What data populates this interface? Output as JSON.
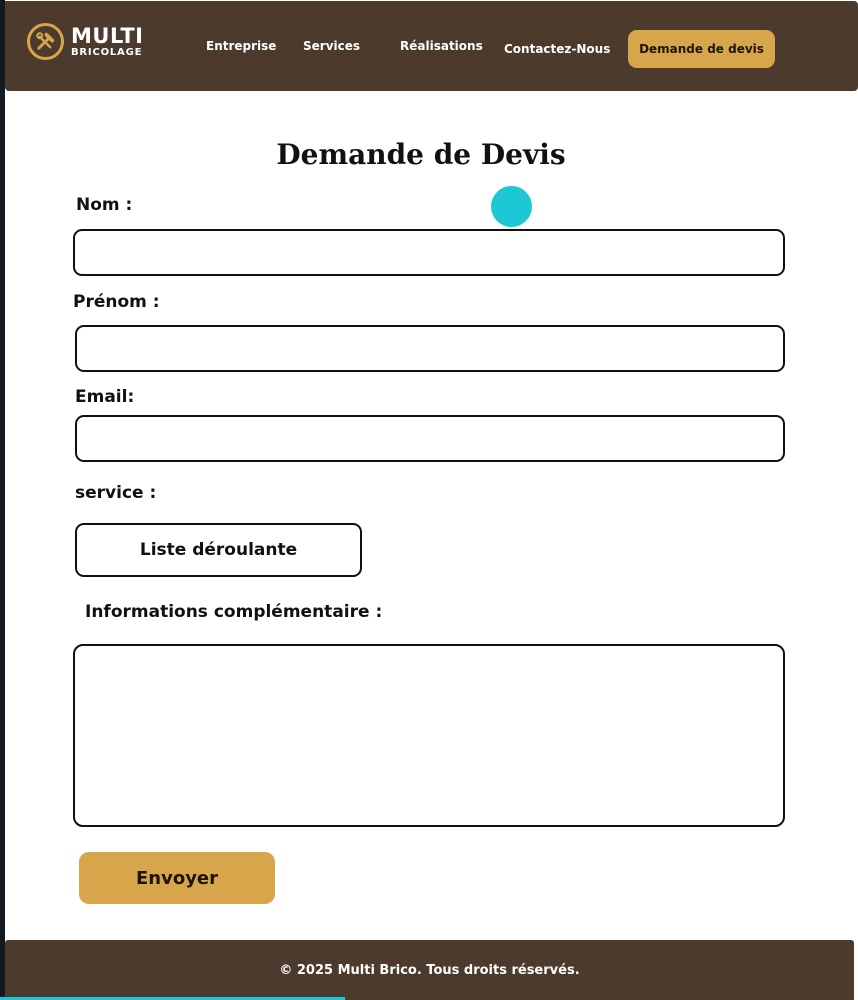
{
  "header": {
    "logo": {
      "title": "MULTI",
      "subtitle": "BRICOLAGE",
      "icon": "tools-icon"
    },
    "nav": [
      {
        "label": "Entreprise"
      },
      {
        "label": "Services"
      },
      {
        "label": "Réalisations"
      },
      {
        "label": "Contactez-Nous"
      }
    ],
    "cta_label": "Demande de devis"
  },
  "form": {
    "title": "Demande de Devis",
    "fields": {
      "nom": {
        "label": "Nom :",
        "value": ""
      },
      "prenom": {
        "label": "Prénom :",
        "value": ""
      },
      "email": {
        "label": "Email:",
        "value": ""
      },
      "service": {
        "label": "service :",
        "selected": "Liste déroulante"
      },
      "infos": {
        "label": "Informations complémentaire :",
        "value": ""
      }
    },
    "submit_label": "Envoyer"
  },
  "footer": {
    "text": "© 2025 Multi Brico. Tous droits réservés."
  },
  "colors": {
    "brand_brown": "#4c3b2d",
    "accent_gold": "#d8a64a",
    "cursor_cyan": "#1dc7d4"
  }
}
